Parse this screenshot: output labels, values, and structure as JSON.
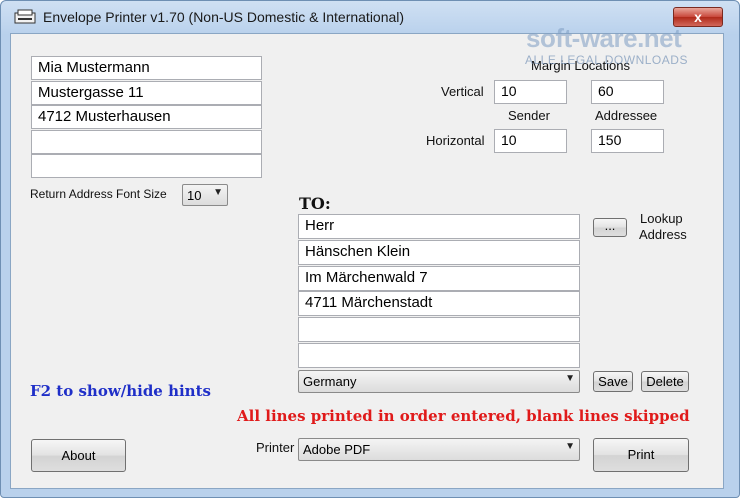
{
  "window": {
    "title": "Envelope Printer v1.70 (Non-US Domestic & International)",
    "close_glyph": "x",
    "icon": "envelope-printer-icon"
  },
  "watermark": {
    "brand": "soft-ware.net",
    "tagline": "ALLE LEGAL DOWNLOADS"
  },
  "sender": {
    "lines": [
      "Mia Mustermann",
      "Mustergasse 11",
      "4712 Musterhausen",
      "",
      ""
    ],
    "font_size_label": "Return Address Font Size",
    "font_size_value": "10"
  },
  "margins": {
    "title": "Margin Locations",
    "vertical_label": "Vertical",
    "horizontal_label": "Horizontal",
    "sender_label": "Sender",
    "addressee_label": "Addressee",
    "vertical_sender": "10",
    "vertical_addressee": "60",
    "horizontal_sender": "10",
    "horizontal_addressee": "150"
  },
  "recipient": {
    "to_label": "TO:",
    "lines": [
      "Herr",
      "Hänschen Klein",
      "Im Märchenwald 7",
      "4711 Märchenstadt",
      "",
      ""
    ],
    "lookup_button": "...",
    "lookup_label_1": "Lookup",
    "lookup_label_2": "Address",
    "country": "Germany",
    "save_button": "Save",
    "delete_button": "Delete"
  },
  "hints": {
    "toggle_text": "F2 to show/hide hints",
    "info_text": "All lines printed in order entered, blank lines skipped"
  },
  "footer": {
    "about_button": "About",
    "printer_label": "Printer",
    "printer_value": "Adobe PDF",
    "print_button": "Print"
  },
  "colors": {
    "hint_blue": "#1f2fc8",
    "info_red": "#e01a1a"
  }
}
